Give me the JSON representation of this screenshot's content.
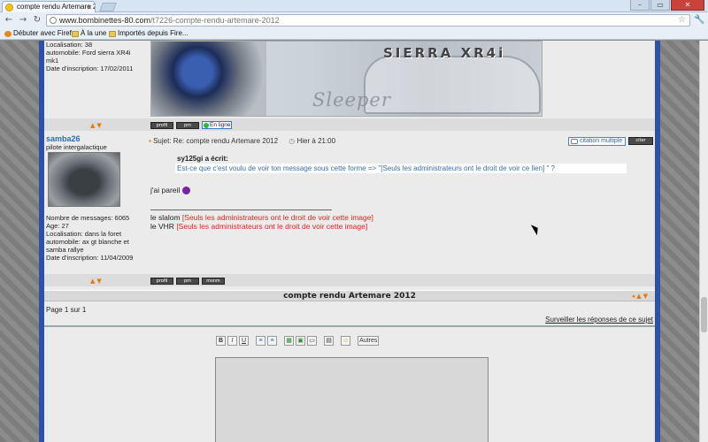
{
  "browser": {
    "tab_title": "compte rendu Artemare 20...",
    "tab_close": "×",
    "url_host": "www.bombinettes-80.com",
    "url_path": "/t7226-compte-rendu-artemare-2012",
    "bookmarks": [
      "Débuter avec Firefox",
      "À la une",
      "Importés depuis Fire..."
    ],
    "window_buttons": [
      "–",
      "▭",
      "✕"
    ]
  },
  "prev_post": {
    "profile_lines": [
      "Localisation: 38",
      "automobile: Ford sierra XR4i mk1",
      "Date d'inscription: 17/02/2011"
    ],
    "banner_logo": "SIERRA XR4i",
    "banner_text": "Sleeper",
    "buttons": [
      "profil",
      "pm"
    ],
    "online_label": "En ligne"
  },
  "post": {
    "username": "samba26",
    "rank": "pilote intergalactique",
    "stats": [
      "Nombre de messages: 6065",
      "Age: 27",
      "Localisation: dans la foret",
      "automobile: ax gt blanche et samba rallye",
      "Date d'inscription: 11/04/2009"
    ],
    "subject_label": "Sujet: Re: compte rendu Artemare 2012",
    "time_label": "Hier à 21:00",
    "multi_quote": "citation multiple",
    "quote_btn": "citer",
    "quote_author": "sy125gi a écrit:",
    "quote_text": "Est-ce que c'est voulu de voir ton message sous cette forme => \"[Seuls les administrateurs ont le droit de voir ce lien] \" ?",
    "reply_text": "j'ai pareil",
    "sig_prefix_1": "le slalom",
    "sig_hidden_1": "[Seuls les administrateurs ont le droit de voir cette image]",
    "sig_prefix_2": "le VHR",
    "sig_hidden_2": "[Seuls les administrateurs ont le droit de voir cette image]",
    "buttons": [
      "profil",
      "pm",
      "msnm"
    ]
  },
  "topic": {
    "title": "compte rendu Artemare 2012",
    "pagination": "Page 1 sur 1",
    "watch_link": "Surveiller les réponses de ce sujet"
  },
  "editor": {
    "buttons": [
      "B",
      "I",
      "U",
      "≡",
      "≡",
      "▦",
      "▣",
      "▭",
      "▤",
      "☺",
      "Autres"
    ]
  },
  "colors": {
    "frame_blue": "#2c52a8",
    "username_blue": "#2a6cc0",
    "hidden_red": "#e0261f"
  }
}
